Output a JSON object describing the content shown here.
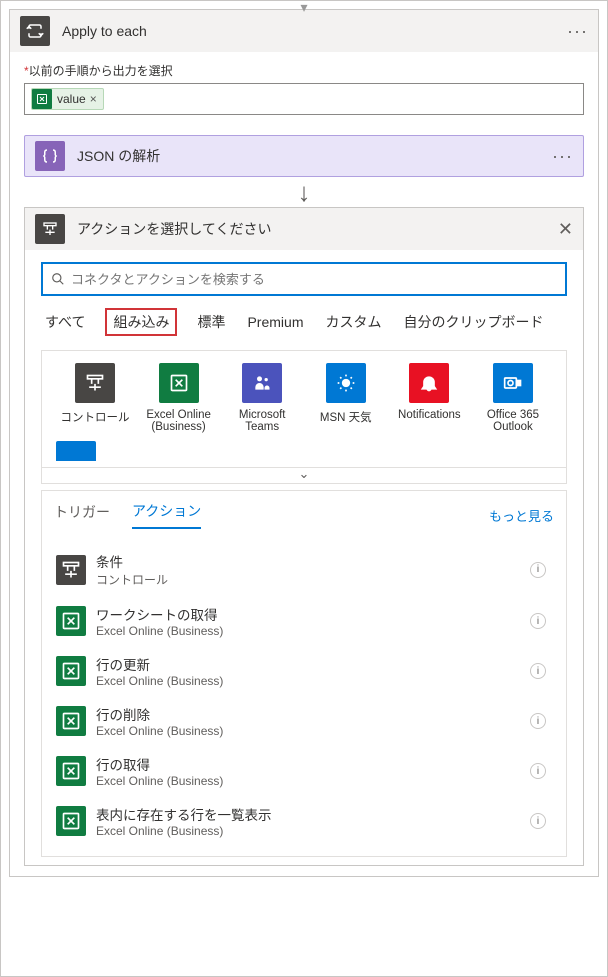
{
  "apply_to_each": {
    "title": "Apply to each",
    "field_label": "以前の手順から出力を選択",
    "token_label": "value"
  },
  "json_parse": {
    "title": "JSON の解析"
  },
  "picker": {
    "title": "アクションを選択してください",
    "search_placeholder": "コネクタとアクションを検索する",
    "tabs": [
      "すべて",
      "組み込み",
      "標準",
      "Premium",
      "カスタム",
      "自分のクリップボード"
    ],
    "highlighted_tab": "組み込み"
  },
  "connectors": [
    {
      "name": "コントロール",
      "icon": "control"
    },
    {
      "name": "Excel Online (Business)",
      "icon": "excel"
    },
    {
      "name": "Microsoft Teams",
      "icon": "teams"
    },
    {
      "name": "MSN 天気",
      "icon": "weather"
    },
    {
      "name": "Notifications",
      "icon": "notif"
    },
    {
      "name": "Office 365 Outlook",
      "icon": "outlook"
    }
  ],
  "actions_section": {
    "tab_triggers": "トリガー",
    "tab_actions": "アクション",
    "more": "もっと見る"
  },
  "actions": [
    {
      "title": "条件",
      "subtitle": "コントロール",
      "icon": "control"
    },
    {
      "title": "ワークシートの取得",
      "subtitle": "Excel Online (Business)",
      "icon": "excel"
    },
    {
      "title": "行の更新",
      "subtitle": "Excel Online (Business)",
      "icon": "excel"
    },
    {
      "title": "行の削除",
      "subtitle": "Excel Online (Business)",
      "icon": "excel"
    },
    {
      "title": "行の取得",
      "subtitle": "Excel Online (Business)",
      "icon": "excel"
    },
    {
      "title": "表内に存在する行を一覧表示",
      "subtitle": "Excel Online (Business)",
      "icon": "excel"
    }
  ]
}
